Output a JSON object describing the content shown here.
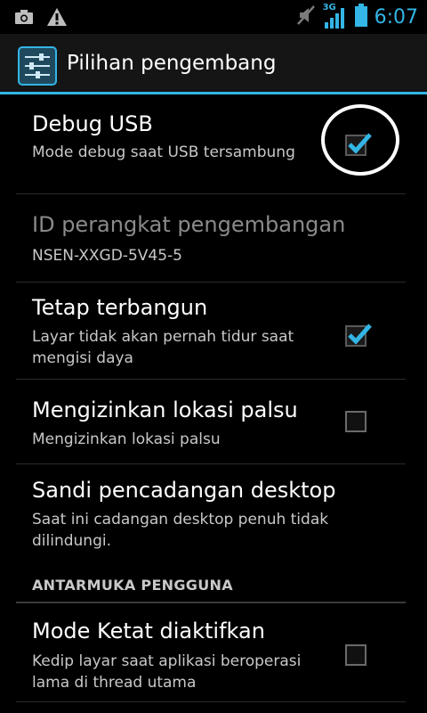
{
  "status_bar": {
    "time": "6:07",
    "network": "3G",
    "icons": [
      "camera-icon",
      "warning-icon",
      "mute-icon",
      "signal-icon",
      "battery-icon"
    ]
  },
  "action_bar": {
    "title": "Pilihan pengembang",
    "icon": "settings-sliders-icon"
  },
  "preferences": [
    {
      "title": "Debug USB",
      "summary": "Mode debug saat USB tersambung",
      "checkbox": true,
      "checked": true,
      "enabled": true
    },
    {
      "title": "ID perangkat pengembangan",
      "summary": "NSEN-XXGD-5V45-5",
      "checkbox": false,
      "enabled": false
    },
    {
      "title": "Tetap terbangun",
      "summary": "Layar tidak akan pernah tidur saat mengisi daya",
      "checkbox": true,
      "checked": true,
      "enabled": true
    },
    {
      "title": "Mengizinkan lokasi palsu",
      "summary": "Mengizinkan lokasi palsu",
      "checkbox": true,
      "checked": false,
      "enabled": true
    },
    {
      "title": "Sandi pencadangan desktop",
      "summary": "Saat ini cadangan desktop penuh tidak dilindungi.",
      "checkbox": false,
      "enabled": true
    }
  ],
  "category": {
    "label": "ANTARMUKA PENGGUNA"
  },
  "ui_preferences": [
    {
      "title": "Mode Ketat diaktifkan",
      "summary": "Kedip layar saat aplikasi beroperasi lama di thread utama",
      "checkbox": true,
      "checked": false,
      "enabled": true
    }
  ],
  "colors": {
    "accent": "#33b5e5",
    "background": "#000000",
    "actionbar": "#151515"
  }
}
